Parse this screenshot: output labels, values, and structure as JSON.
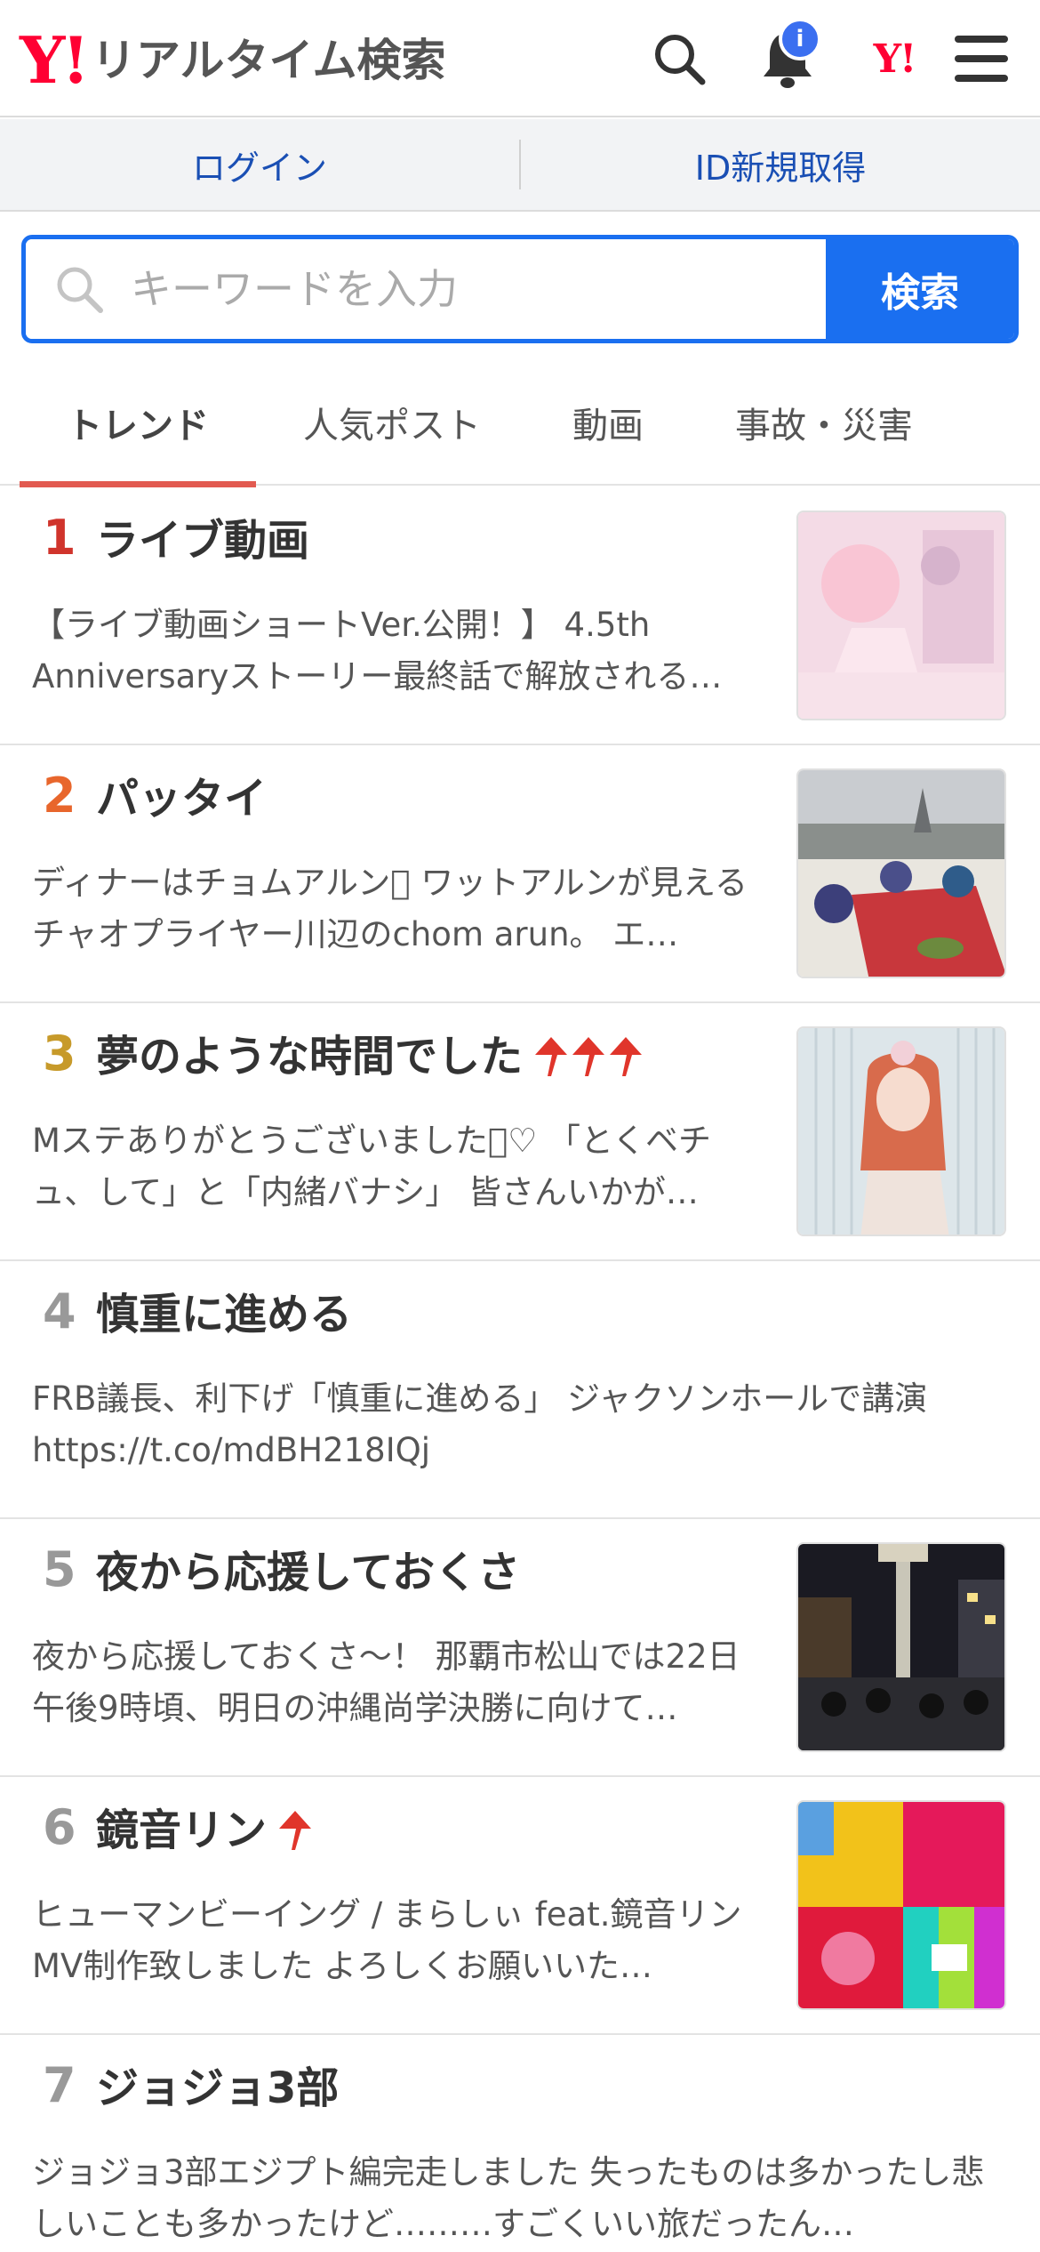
{
  "header": {
    "logo_mark": "Y!",
    "logo_title": "リアルタイム検索",
    "notification_badge": "i",
    "brand_mark": "Y!"
  },
  "login_bar": {
    "login_label": "ログイン",
    "signup_label": "ID新規取得"
  },
  "search": {
    "placeholder": "キーワードを入力",
    "value": "",
    "button_label": "検索"
  },
  "tabs": [
    {
      "label": "トレンド",
      "active": true
    },
    {
      "label": "人気ポスト",
      "active": false
    },
    {
      "label": "動画",
      "active": false
    },
    {
      "label": "事故・災害",
      "active": false
    }
  ],
  "colors": {
    "accent": "#1a6ff0",
    "brand": "#ff0033",
    "tab_underline": "#e25a50",
    "rank1": "#d0342c",
    "rank2": "#e8662c",
    "rank3": "#c79a2a",
    "rank_other": "#999999",
    "up_arrow": "#e0352b"
  },
  "trends": [
    {
      "rank": "1",
      "title": "ライブ動画",
      "up_arrows": 0,
      "desc": "【ライブ動画ショートVer.公開！】 4.5th Anniversaryストーリー最終話で解放される…",
      "thumbnail": "anime-character-thumbnail"
    },
    {
      "rank": "2",
      "title": "パッタイ",
      "up_arrows": 0,
      "desc": "ディナーはチョムアルン󾭛 ワットアルンが見えるチャオプライヤー川辺のchom arun。 エ…",
      "thumbnail": "dinner-photo-thumbnail"
    },
    {
      "rank": "3",
      "title": "夢のような時間でした",
      "up_arrows": 3,
      "desc": "Mステありがとうございました󾭛♡ 「とくベチュ、して」と「内緒バナシ」 皆さんいかが…",
      "thumbnail": "idol-photo-thumbnail"
    },
    {
      "rank": "4",
      "title": "慎重に進める",
      "up_arrows": 0,
      "desc": "FRB議長、利下げ「慎重に進める」 ジャクソンホールで講演 https://t.co/mdBH218IQj",
      "thumbnail": ""
    },
    {
      "rank": "5",
      "title": "夜から応援しておくさ",
      "up_arrows": 0,
      "desc": "夜から応援しておくさ〜！ 那覇市松山では22日午後9時頃、明日の沖縄尚学決勝に向けて…",
      "thumbnail": "night-street-thumbnail"
    },
    {
      "rank": "6",
      "title": "鏡音リン",
      "up_arrows": 1,
      "desc": "ヒューマンビーイング / まらしぃ feat.鏡音リン MV制作致しました よろしくお願いいた…",
      "thumbnail": "music-video-thumbnail"
    },
    {
      "rank": "7",
      "title": "ジョジョ3部",
      "up_arrows": 0,
      "desc": "ジョジョ3部エジプト編完走しました 失ったものは多かったし悲しいことも多かったけど………すごくいい旅だったん…",
      "thumbnail": ""
    }
  ]
}
